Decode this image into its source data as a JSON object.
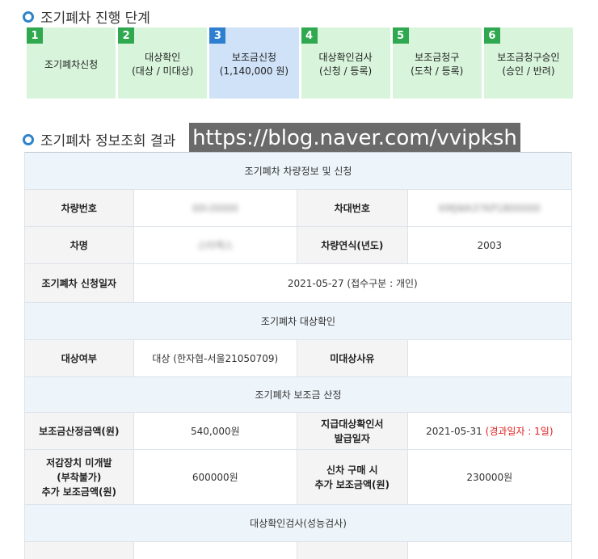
{
  "progress": {
    "title": "조기폐차 진행 단계",
    "steps": [
      {
        "num": "1",
        "label": "조기폐차신청"
      },
      {
        "num": "2",
        "label": "대상확인\n(대상 / 미대상)"
      },
      {
        "num": "3",
        "label": "보조금신청\n(1,140,000 원)"
      },
      {
        "num": "4",
        "label": "대상확인검사\n(신청 / 등록)"
      },
      {
        "num": "5",
        "label": "보조금청구\n(도착 / 등록)"
      },
      {
        "num": "6",
        "label": "보조금청구승인\n(승인 / 반려)"
      }
    ],
    "active_step": 3
  },
  "info": {
    "title": "조기폐차 정보조회 결과",
    "watermark": "https://blog.naver.com/vvipksh",
    "vehicle_header": "조기폐차 차량정보 및 신청",
    "plate_label": "차량번호",
    "plate_value": "00나0000",
    "chassis_label": "차대번호",
    "chassis_value": "KMJWA37KP1B00000",
    "model_label": "차명",
    "model_value": "스타렉스",
    "year_label": "차량연식(년도)",
    "year_value": "2003",
    "apply_date_label": "조기폐차 신청일자",
    "apply_date_value": "2021-05-27 (접수구분 : 개인)",
    "target_header": "조기폐차 대상확인",
    "target_label": "대상여부",
    "target_value": "대상 (한자협-서울21050709)",
    "non_target_label": "미대상사유",
    "non_target_value": "",
    "subsidy_header": "조기폐차 보조금 산정",
    "subsidy_amount_label": "보조금산정금액(원)",
    "subsidy_amount_value": "540,000원",
    "issue_date_label": "지급대상확인서\n발급일자",
    "issue_date_value": "2021-05-31",
    "issue_date_elapsed": "(경과일자 : 1일)",
    "reduction_label": "저감장치 미개발\n(부착불가)\n추가 보조금액(원)",
    "reduction_value": "600000원",
    "newcar_label": "신차 구매 시\n추가 보조금액(원)",
    "newcar_value": "230000원",
    "inspection_header": "대상확인검사(성능검사)"
  },
  "colors": {
    "accent": "#2e83c9",
    "step_bg": "#d8f5dc",
    "step_active_bg": "#cfe2f7",
    "step_num": "#2fa84f",
    "step_num_active": "#2e7fd0",
    "header_bg": "#edf5fb",
    "label_bg": "#f4f4f4",
    "elapsed_red": "#e02020"
  }
}
